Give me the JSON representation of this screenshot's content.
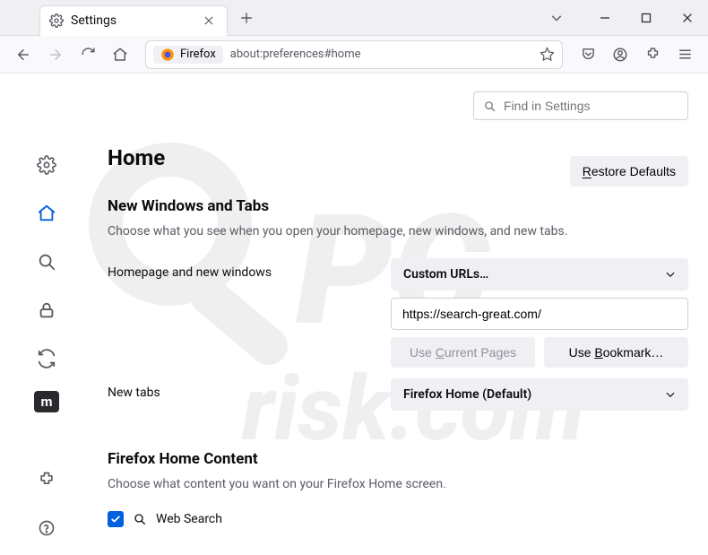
{
  "titlebar": {
    "tab_title": "Settings"
  },
  "toolbar": {
    "addr_label": "Firefox",
    "addr_url": "about:preferences#home"
  },
  "search": {
    "placeholder": "Find in Settings"
  },
  "page": {
    "title": "Home",
    "restore_btn": "Restore Defaults"
  },
  "nwt": {
    "heading": "New Windows and Tabs",
    "desc": "Choose what you see when you open your homepage, new windows, and new tabs.",
    "row1_label": "Homepage and new windows",
    "dropdown1": "Custom URLs…",
    "url_value": "https://search-great.com/",
    "btn_current": "Use Current Pages",
    "btn_bookmark": "Use Bookmark…",
    "row2_label": "New tabs",
    "dropdown2": "Firefox Home (Default)"
  },
  "fhc": {
    "heading": "Firefox Home Content",
    "desc": "Choose what content you want on your Firefox Home screen.",
    "opt_websearch": "Web Search"
  }
}
